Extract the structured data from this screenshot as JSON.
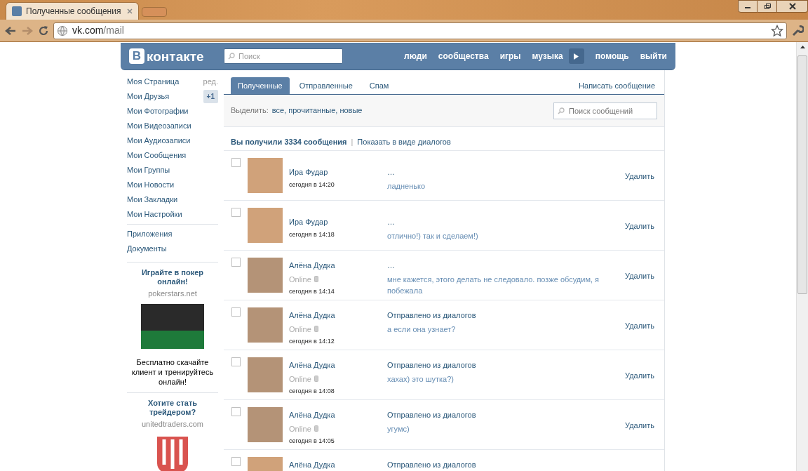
{
  "browser": {
    "tab_title": "Полученные сообщения",
    "url_host": "vk.com",
    "url_path": "/mail"
  },
  "header": {
    "logo_letter": "В",
    "logo_text": "контакте",
    "search_placeholder": "Поиск",
    "nav": [
      "люди",
      "сообщества",
      "игры",
      "музыка",
      "помощь",
      "выйти"
    ]
  },
  "sidebar": {
    "items": [
      {
        "label": "Моя Страница",
        "extra": "ред.",
        "kind": "link"
      },
      {
        "label": "Мои Друзья",
        "extra": "+1",
        "kind": "badge"
      },
      {
        "label": "Мои Фотографии"
      },
      {
        "label": "Мои Видеозаписи"
      },
      {
        "label": "Мои Аудиозаписи"
      },
      {
        "label": "Мои Сообщения"
      },
      {
        "label": "Мои Группы"
      },
      {
        "label": "Мои Новости"
      },
      {
        "label": "Мои Закладки"
      },
      {
        "label": "Мои Настройки"
      }
    ],
    "extra_items": [
      "Приложения",
      "Документы"
    ],
    "ads": [
      {
        "title": "Играйте в покер онлайн!",
        "domain": "pokerstars.net",
        "kind": "photo",
        "text": "Бесплатно скачайте клиент и тренируйтесь онлайн!"
      },
      {
        "title": "Хотите стать трейдером?",
        "domain": "unitedtraders.com",
        "kind": "logo"
      }
    ]
  },
  "mail": {
    "tabs": [
      {
        "label": "Полученные",
        "selected": true
      },
      {
        "label": "Отправленные",
        "selected": false
      },
      {
        "label": "Спам",
        "selected": false
      }
    ],
    "compose": "Написать сообщение",
    "select_label": "Выделить:",
    "select_options": "все, прочитанные, новые",
    "search_placeholder": "Поиск сообщений",
    "summary": "Вы получили 3334 сообщения",
    "separator": "|",
    "dialogs_link": "Показать в виде диалогов",
    "messages": [
      {
        "checked": false,
        "name": "Ира Фудар",
        "time": "сегодня в 14:20",
        "title": "…",
        "text": "ладненько",
        "delete": "Удалить"
      },
      {
        "checked": false,
        "name": "Ира Фудар",
        "time": "сегодня в 14:18",
        "title": "…",
        "text": "отлично!) так и сделаем!)",
        "delete": "Удалить"
      },
      {
        "checked": false,
        "name": "Алёна Дудка",
        "status": "Online",
        "time": "сегодня в 14:14",
        "title": "…",
        "text": "мне кажется, этого делать не следовало. позже обсудим, я побежала",
        "delete": "Удалить"
      },
      {
        "checked": false,
        "name": "Алёна Дудка",
        "status": "Online",
        "time": "сегодня в 14:12",
        "title": "Отправлено из диалогов",
        "text": "а если она узнает?",
        "delete": "Удалить"
      },
      {
        "checked": false,
        "name": "Алёна Дудка",
        "status": "Online",
        "time": "сегодня в 14:08",
        "title": "Отправлено из диалогов",
        "text": "хахах) это шутка?)",
        "delete": "Удалить"
      },
      {
        "checked": false,
        "name": "Алёна Дудка",
        "status": "Online",
        "time": "сегодня в 14:05",
        "title": "Отправлено из диалогов",
        "text": "угумс)",
        "delete": "Удалить"
      },
      {
        "checked": false,
        "name": "Алёна Дудка",
        "title": "Отправлено из диалогов"
      }
    ]
  }
}
